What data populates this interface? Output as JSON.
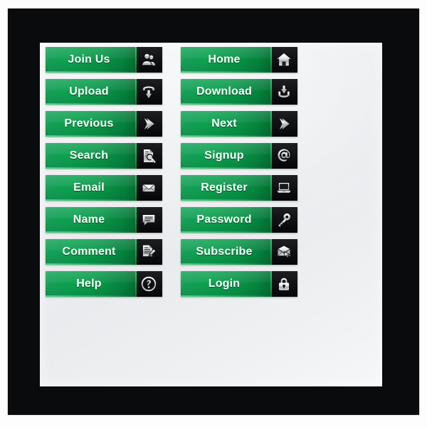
{
  "artboard": {
    "background_color": "#fdfdfd",
    "frame_color": "#090b0c",
    "panel_color": "#eceef0",
    "accent_green": "#0ca14f",
    "icon_plate_color": "#111315",
    "label_text_color": "#ffffff"
  },
  "button_set": {
    "columns": [
      {
        "name": "left-column",
        "buttons": [
          {
            "label": "Join Us",
            "icon": "users-icon"
          },
          {
            "label": "Upload",
            "icon": "upload-tray-icon"
          },
          {
            "label": "Previous",
            "icon": "arrow-right-chevron-icon"
          },
          {
            "label": "Search",
            "icon": "document-magnifier-icon"
          },
          {
            "label": "Email",
            "icon": "envelope-icon"
          },
          {
            "label": "Name",
            "icon": "speech-bubble-icon"
          },
          {
            "label": "Comment",
            "icon": "document-pen-icon"
          },
          {
            "label": "Help",
            "icon": "question-mark-circle-icon"
          }
        ]
      },
      {
        "name": "right-column",
        "buttons": [
          {
            "label": "Home",
            "icon": "house-icon"
          },
          {
            "label": "Download",
            "icon": "download-tray-icon"
          },
          {
            "label": "Next",
            "icon": "arrow-right-chevron-icon"
          },
          {
            "label": "Signup",
            "icon": "at-sign-icon"
          },
          {
            "label": "Register",
            "icon": "laptop-icon"
          },
          {
            "label": "Password",
            "icon": "key-icon"
          },
          {
            "label": "Subscribe",
            "icon": "envelope-cursor-icon"
          },
          {
            "label": "Login",
            "icon": "padlock-icon"
          }
        ]
      }
    ]
  }
}
